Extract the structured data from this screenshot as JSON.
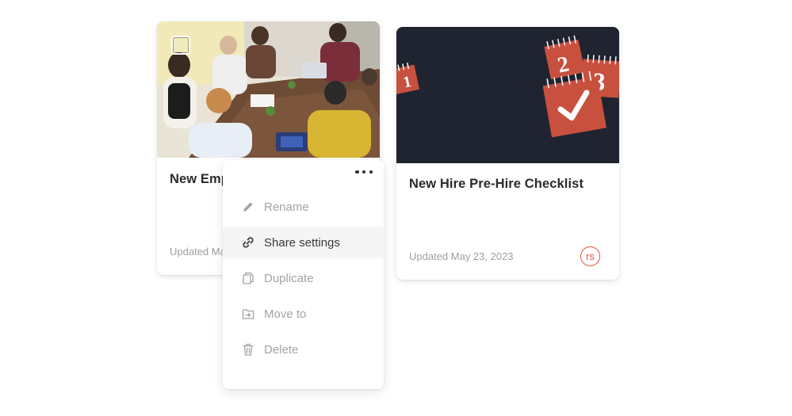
{
  "cards": [
    {
      "title": "New Emp",
      "updated": "Updated Ma",
      "image_desc_icon": "team-photo"
    },
    {
      "title": "New Hire Pre-Hire Checklist",
      "updated": "Updated May 23, 2023",
      "avatar_initials": "rs",
      "calendar_numbers": [
        "1",
        "2",
        "3"
      ]
    }
  ],
  "menu": {
    "more_icon": "more-dots-icon",
    "items": [
      {
        "label": "Rename",
        "icon": "pencil-icon",
        "active": false
      },
      {
        "label": "Share settings",
        "icon": "link-icon",
        "active": true
      },
      {
        "label": "Duplicate",
        "icon": "copy-icon",
        "active": false
      },
      {
        "label": "Move to",
        "icon": "move-to-folder-icon",
        "active": false
      },
      {
        "label": "Delete",
        "icon": "trash-icon",
        "active": false
      }
    ]
  },
  "colors": {
    "accent": "#e0563f",
    "calendar_red": "#c8503f",
    "dark_thumb": "#1f2430"
  }
}
